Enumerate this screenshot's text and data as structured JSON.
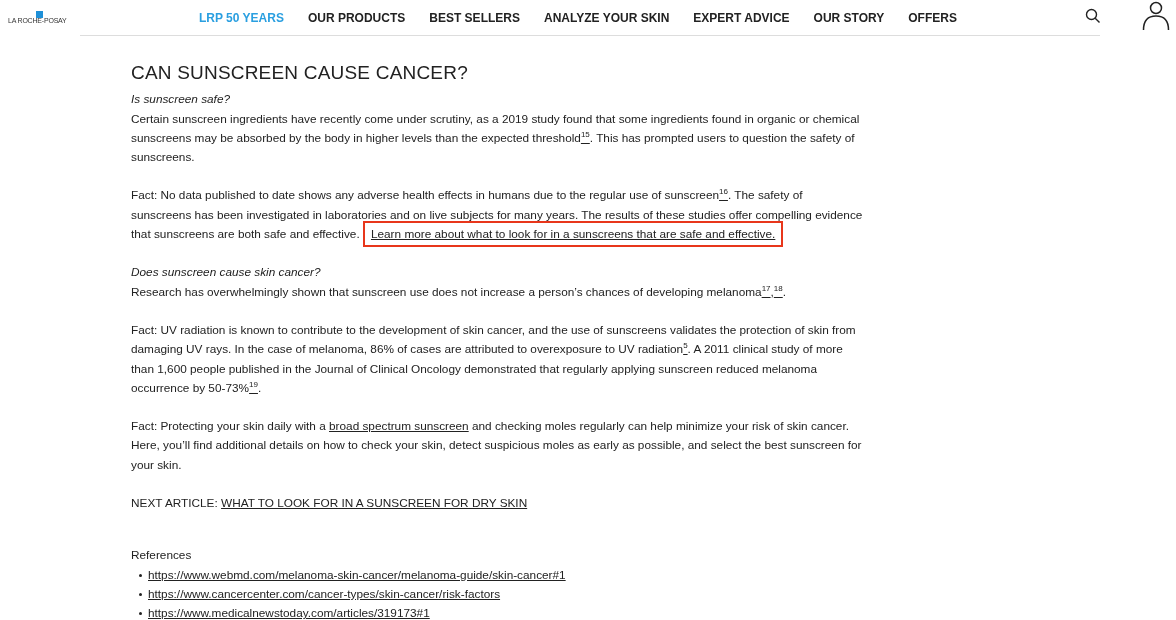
{
  "header": {
    "logo": "LA ROCHE-POSAY",
    "nav": [
      {
        "label": "LRP 50 YEARS",
        "selected": true
      },
      {
        "label": "OUR PRODUCTS",
        "selected": false
      },
      {
        "label": "BEST SELLERS",
        "selected": false
      },
      {
        "label": "ANALYZE YOUR SKIN",
        "selected": false
      },
      {
        "label": "EXPERT ADVICE",
        "selected": false
      },
      {
        "label": "OUR STORY",
        "selected": false
      },
      {
        "label": "OFFERS",
        "selected": false
      }
    ]
  },
  "article": {
    "title": "CAN SUNSCREEN CAUSE CANCER?",
    "blocks": [
      {
        "kind": "question",
        "text": "Is sunscreen safe?"
      },
      {
        "kind": "paragraph",
        "segments": [
          {
            "kind": "text",
            "text": "Certain sunscreen ingredients have recently come under scrutiny, as a 2019 study found that some ingredients found in organic or chemical sunscreens may be absorbed by the body in higher levels than the expected threshold"
          },
          {
            "kind": "footnote",
            "text": "15"
          },
          {
            "kind": "text",
            "text": ". This has prompted users to question the safety of sunscreens."
          }
        ]
      },
      {
        "kind": "paragraph",
        "segments": [
          {
            "kind": "text",
            "text": "Fact: No data published to date shows any adverse health effects in humans due to the regular use of sunscreen"
          },
          {
            "kind": "footnote",
            "text": "16"
          },
          {
            "kind": "text",
            "text": ". The safety of sunscreens has been investigated in laboratories and on live subjects for many years. The results of these studies offer compelling evidence that sunscreens are both safe and effective. "
          },
          {
            "kind": "link",
            "text": "Learn more about what to look for in a sunscreens that are safe and effective.",
            "highlighted": true
          }
        ]
      },
      {
        "kind": "question",
        "text": "Does sunscreen cause skin cancer?"
      },
      {
        "kind": "paragraph",
        "segments": [
          {
            "kind": "text",
            "text": "Research has overwhelmingly shown that sunscreen use does not increase a person’s chances of developing melanoma"
          },
          {
            "kind": "footnote",
            "text": "17"
          },
          {
            "kind": "text",
            "text": ","
          },
          {
            "kind": "footnote",
            "text": "18"
          },
          {
            "kind": "text",
            "text": "."
          }
        ]
      },
      {
        "kind": "paragraph",
        "segments": [
          {
            "kind": "text",
            "text": "Fact: UV radiation is known to contribute to the development of skin cancer, and the use of sunscreens validates the protection of skin from damaging UV rays. In the case of melanoma, 86% of cases are attributed to overexposure to UV radiation"
          },
          {
            "kind": "footnote",
            "text": "5"
          },
          {
            "kind": "text",
            "text": ". A 2011 clinical study of more than 1,600 people published in the Journal of Clinical Oncology demonstrated that regularly applying sunscreen reduced melanoma occurrence by 50-73%"
          },
          {
            "kind": "footnote",
            "text": "19"
          },
          {
            "kind": "text",
            "text": "."
          }
        ]
      },
      {
        "kind": "paragraph",
        "segments": [
          {
            "kind": "text",
            "text": "Fact: Protecting your skin daily with a "
          },
          {
            "kind": "link",
            "text": "broad spectrum sunscreen",
            "highlighted": false
          },
          {
            "kind": "text",
            "text": " and checking moles regularly can help minimize your risk of skin cancer. Here, you’ll find additional details on how to check your skin, detect suspicious moles as early as possible, and select the best sunscreen for your skin."
          }
        ]
      },
      {
        "kind": "paragraph",
        "segments": [
          {
            "kind": "text",
            "text": "NEXT ARTICLE: "
          },
          {
            "kind": "link",
            "text": "WHAT TO LOOK FOR IN A SUNSCREEN FOR DRY SKIN",
            "highlighted": false
          }
        ]
      }
    ],
    "references": {
      "heading": "References",
      "items": [
        "https://www.webmd.com/melanoma-skin-cancer/melanoma-guide/skin-cancer#1",
        "https://www.cancercenter.com/cancer-types/skin-cancer/risk-factors",
        "https://www.medicalnewstoday.com/articles/319173#1"
      ]
    }
  }
}
